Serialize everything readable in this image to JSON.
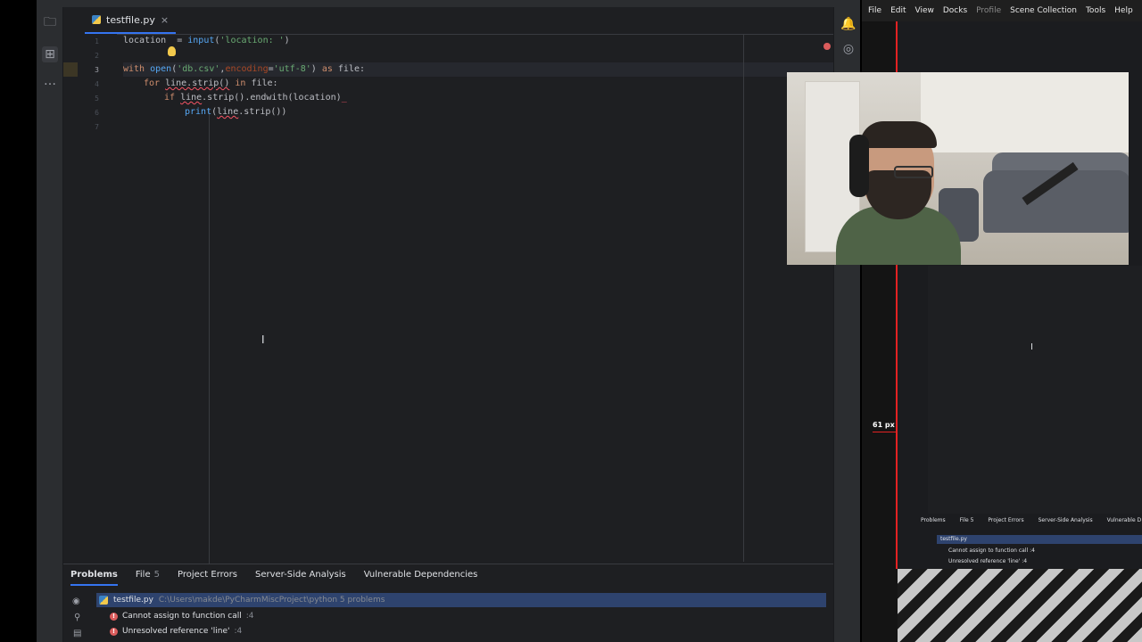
{
  "editor": {
    "tab_filename": "testfile.py",
    "tab_close": "×",
    "line_numbers": [
      "1",
      "2",
      "3",
      "4",
      "5",
      "6",
      "7"
    ],
    "lines": {
      "l1": {
        "var": "location",
        "op": "  = ",
        "fn": "input",
        "arg": "'location: '",
        "close": ")"
      },
      "l3": {
        "kw1": "with ",
        "fn": "open",
        "s1": "'db.csv'",
        "comma": ",",
        "param": "encoding",
        "eq": "=",
        "s2": "'utf-8'",
        "rest": ") ",
        "kw2": "as",
        "tail": " file:"
      },
      "l4": {
        "kw": "for ",
        "expr": "line.strip()",
        "kw2": " in ",
        "tail": "file:"
      },
      "l5": {
        "kw": "if ",
        "err": "line",
        "tail": ".strip().endwith(location)",
        "caret": "_"
      },
      "l6": {
        "fn": "print",
        "open": "(",
        "err": "line",
        "tail": ".strip())"
      }
    },
    "inspection_count": "5",
    "inspection_arrows": "^ ⌄"
  },
  "problems_panel": {
    "tabs": [
      {
        "label": "Problems",
        "count": ""
      },
      {
        "label": "File",
        "count": "5"
      },
      {
        "label": "Project Errors",
        "count": ""
      },
      {
        "label": "Server-Side Analysis",
        "count": ""
      },
      {
        "label": "Vulnerable Dependencies",
        "count": ""
      }
    ],
    "file_row": {
      "name": "testfile.py",
      "path": "C:\\Users\\makde\\PyCharmMiscProject\\python  5 problems"
    },
    "items": [
      {
        "text": "Cannot assign to function call",
        "pos": ":4"
      },
      {
        "text": "Unresolved reference 'line'",
        "pos": ":4"
      }
    ]
  },
  "obs": {
    "menu": [
      "File",
      "Edit",
      "View",
      "Docks",
      "Profile",
      "Scene Collection",
      "Tools",
      "Help"
    ],
    "px_label": "61 px",
    "mini_tabs": [
      "Problems",
      "File 5",
      "Project Errors",
      "Server-Side Analysis",
      "Vulnerable D"
    ],
    "mini_file": "testfile.py",
    "mini_items": [
      "Cannot assign to function call :4",
      "Unresolved reference 'line' :4"
    ]
  },
  "colors": {
    "accent": "#3574f0",
    "error": "#db5c5c",
    "obs_border": "#e32222"
  }
}
